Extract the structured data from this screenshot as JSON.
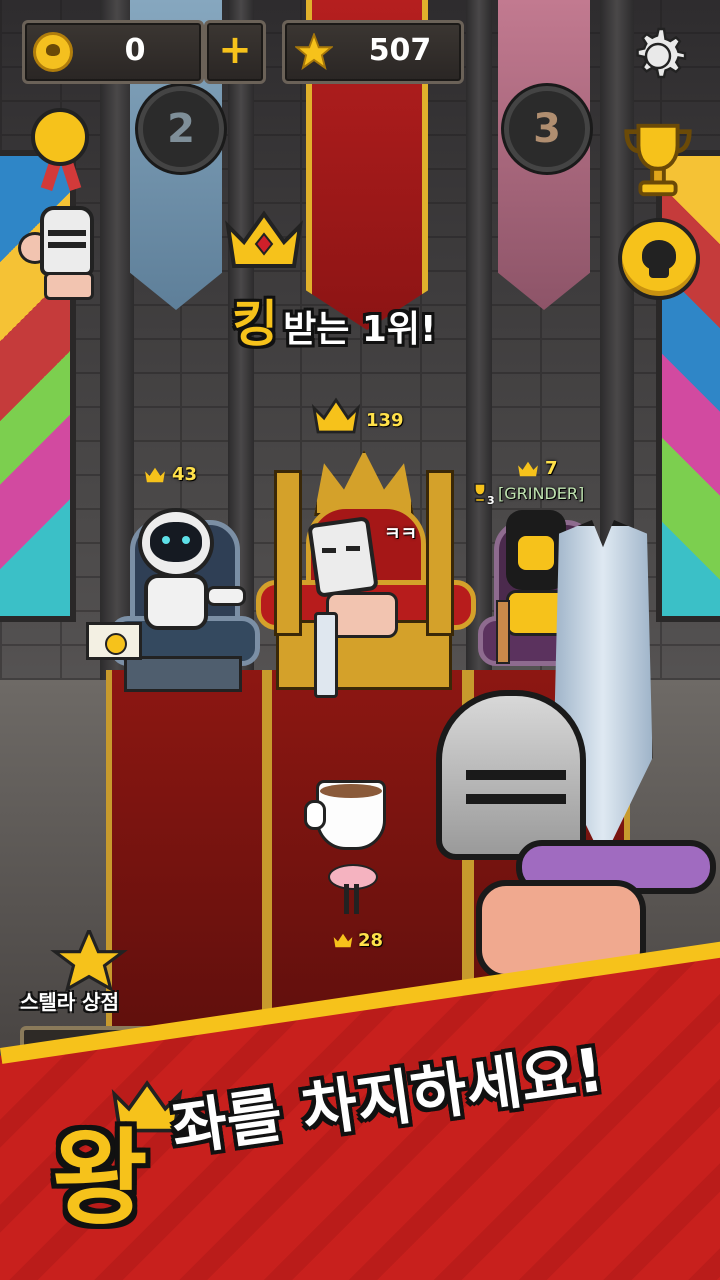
{
  "hud": {
    "skull_coins": "0",
    "plus_label": "+",
    "stars": "507"
  },
  "ranks": {
    "left_rank": "2",
    "right_rank": "3"
  },
  "king_caption": {
    "highlight": "킹",
    "rest": "받는 1위!"
  },
  "players": {
    "king_score": "139",
    "left_score": "43",
    "right_score": "7",
    "right_badge_num": "3",
    "right_tag": "[GRINDER]",
    "front_score": "28",
    "king_speech": "ㅋㅋ"
  },
  "shop": {
    "label": "스텔라 상점"
  },
  "banner": {
    "big_char": "왕",
    "text": "좌를 차지하세요!"
  },
  "colors": {
    "gold": "#f6c21b",
    "red_banner": "#c8201d",
    "carpet": "#7a1410"
  }
}
